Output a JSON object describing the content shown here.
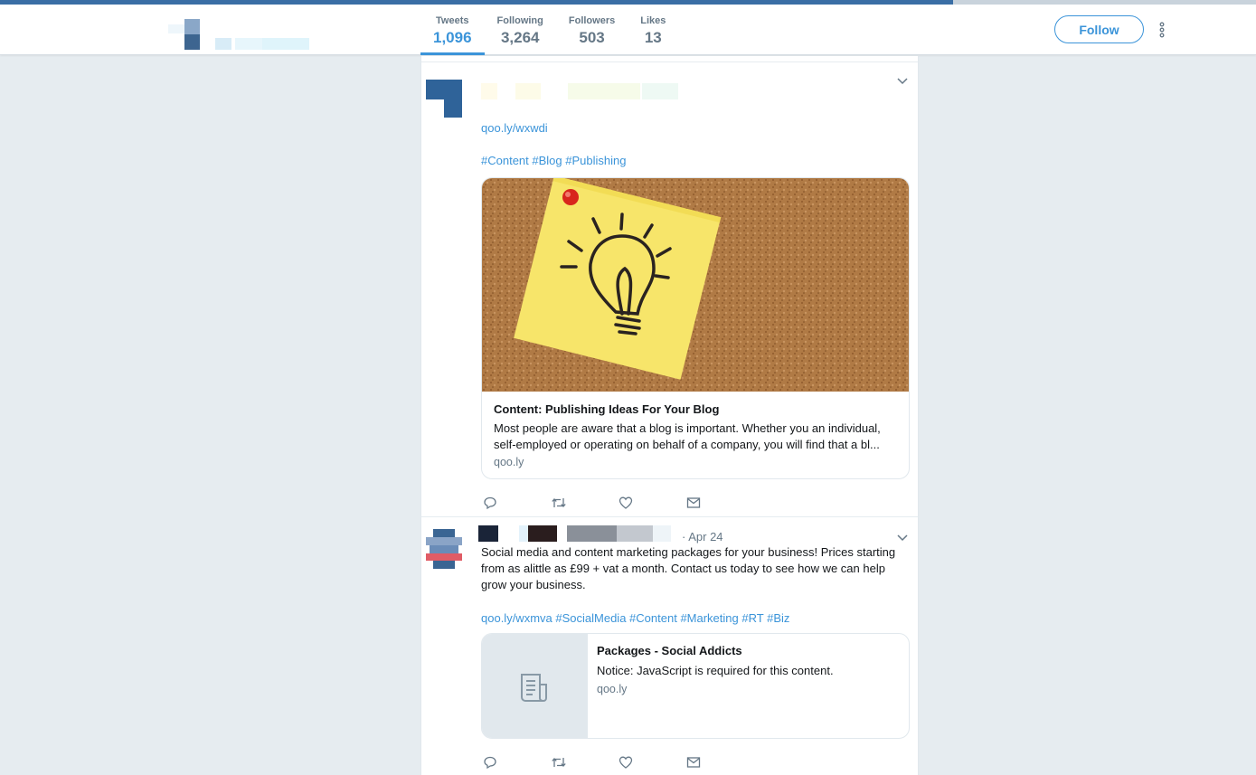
{
  "header": {
    "stats": [
      {
        "label": "Tweets",
        "value": "1,096",
        "active": true
      },
      {
        "label": "Following",
        "value": "3,264",
        "active": false
      },
      {
        "label": "Followers",
        "value": "503",
        "active": false
      },
      {
        "label": "Likes",
        "value": "13",
        "active": false
      }
    ],
    "follow_label": "Follow"
  },
  "tweets": [
    {
      "link": "qoo.ly/wxwdi",
      "hashtags": [
        "#Content",
        "#Blog",
        "#Publishing"
      ],
      "card": {
        "title": "Content: Publishing Ideas For Your Blog",
        "description": "Most people are aware that a blog is important. Whether you an individual, self-employed or operating on behalf of a company, you will find that a bl...",
        "domain": "qoo.ly"
      }
    },
    {
      "date": "· Apr 24",
      "text": "Social media and content marketing packages for your business! Prices starting from as alittle as £99 + vat a month. Contact us today to see how we can help grow your business.",
      "links": [
        "qoo.ly/wxmva",
        "#SocialMedia",
        "#Content",
        "#Marketing",
        "#RT",
        "#Biz"
      ],
      "card": {
        "title": "Packages - Social Addicts",
        "description": "Notice: JavaScript is required for this content.",
        "domain": "qoo.ly"
      }
    }
  ],
  "colors": {
    "accent": "#3b94d9",
    "muted": "#657786",
    "background": "#e6ecf0"
  }
}
